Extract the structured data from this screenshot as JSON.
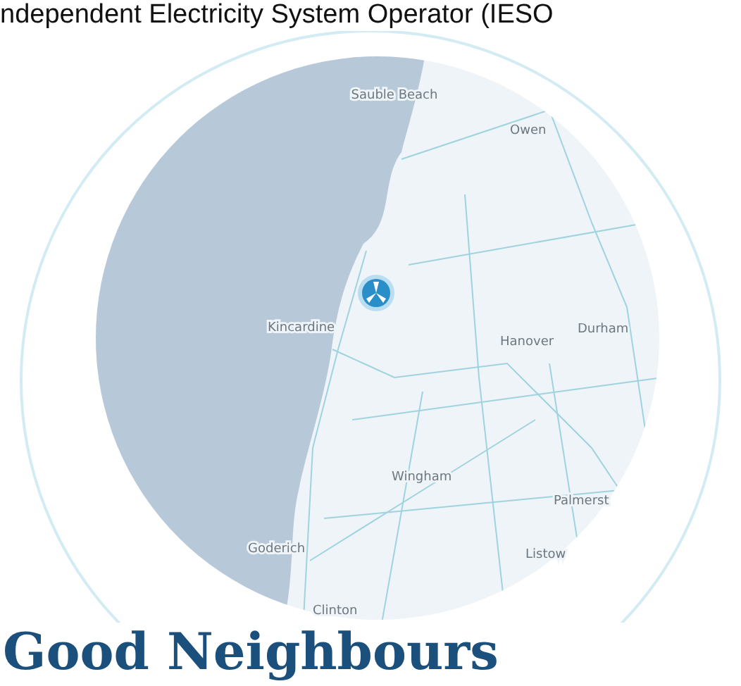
{
  "intro_text": "ndependent Electricity System Operator (IESO",
  "map": {
    "labels": [
      {
        "text": "Sauble Beach"
      },
      {
        "text": "Owen"
      },
      {
        "text": "Kincardine"
      },
      {
        "text": "Hanover"
      },
      {
        "text": "Durham"
      },
      {
        "text": "Wingham"
      },
      {
        "text": "Palmerst"
      },
      {
        "text": "Goderich"
      },
      {
        "text": "Listow"
      },
      {
        "text": "Clinton"
      }
    ]
  },
  "heading": "Good Neighbours"
}
